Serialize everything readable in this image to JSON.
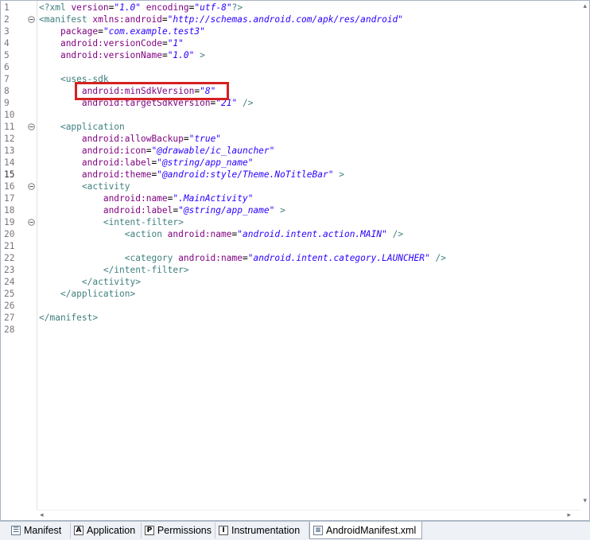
{
  "editor": {
    "lines": [
      {
        "n": "1",
        "fold": "",
        "tokens": [
          [
            "pi",
            "<?"
          ],
          [
            "tag",
            "xml "
          ],
          [
            "attr",
            "version"
          ],
          [
            "eq",
            "="
          ],
          [
            "val",
            "\"1.0\""
          ],
          [
            "eq",
            " "
          ],
          [
            "attr",
            "encoding"
          ],
          [
            "eq",
            "="
          ],
          [
            "val",
            "\"utf-8\""
          ],
          [
            "pi",
            "?>"
          ]
        ]
      },
      {
        "n": "2",
        "fold": "minus",
        "tokens": [
          [
            "tag",
            "<manifest "
          ],
          [
            "attr",
            "xmlns:android"
          ],
          [
            "eq",
            "="
          ],
          [
            "val",
            "\"http://schemas.android.com/apk/res/android\""
          ]
        ]
      },
      {
        "n": "3",
        "fold": "",
        "tokens": [
          [
            "eq",
            "    "
          ],
          [
            "attr",
            "package"
          ],
          [
            "eq",
            "="
          ],
          [
            "val",
            "\"com.example.test3\""
          ]
        ]
      },
      {
        "n": "4",
        "fold": "",
        "tokens": [
          [
            "eq",
            "    "
          ],
          [
            "attr",
            "android:versionCode"
          ],
          [
            "eq",
            "="
          ],
          [
            "val",
            "\"1\""
          ]
        ]
      },
      {
        "n": "5",
        "fold": "",
        "tokens": [
          [
            "eq",
            "    "
          ],
          [
            "attr",
            "android:versionName"
          ],
          [
            "eq",
            "="
          ],
          [
            "val",
            "\"1.0\""
          ],
          [
            "tag",
            " >"
          ]
        ]
      },
      {
        "n": "6",
        "fold": "",
        "tokens": []
      },
      {
        "n": "7",
        "fold": "",
        "tokens": [
          [
            "eq",
            "    "
          ],
          [
            "tag",
            "<uses-sdk"
          ]
        ]
      },
      {
        "n": "8",
        "fold": "",
        "tokens": [
          [
            "eq",
            "        "
          ],
          [
            "attr",
            "android:minSdkVersion"
          ],
          [
            "eq",
            "="
          ],
          [
            "val",
            "\"8\""
          ]
        ]
      },
      {
        "n": "9",
        "fold": "",
        "tokens": [
          [
            "eq",
            "        "
          ],
          [
            "attr",
            "android:targetSdkVersion"
          ],
          [
            "eq",
            "="
          ],
          [
            "val",
            "\"21\""
          ],
          [
            "tag",
            " />"
          ]
        ]
      },
      {
        "n": "10",
        "fold": "",
        "tokens": []
      },
      {
        "n": "11",
        "fold": "minus",
        "tokens": [
          [
            "eq",
            "    "
          ],
          [
            "tag",
            "<application"
          ]
        ]
      },
      {
        "n": "12",
        "fold": "",
        "tokens": [
          [
            "eq",
            "        "
          ],
          [
            "attr",
            "android:allowBackup"
          ],
          [
            "eq",
            "="
          ],
          [
            "val",
            "\"true\""
          ]
        ]
      },
      {
        "n": "13",
        "fold": "",
        "tokens": [
          [
            "eq",
            "        "
          ],
          [
            "attr",
            "android:icon"
          ],
          [
            "eq",
            "="
          ],
          [
            "val",
            "\"@drawable/ic_launcher\""
          ]
        ]
      },
      {
        "n": "14",
        "fold": "",
        "tokens": [
          [
            "eq",
            "        "
          ],
          [
            "attr",
            "android:label"
          ],
          [
            "eq",
            "="
          ],
          [
            "val",
            "\"@string/app_name\""
          ]
        ]
      },
      {
        "n": "15",
        "fold": "",
        "bold": true,
        "tokens": [
          [
            "eq",
            "        "
          ],
          [
            "attr",
            "android:theme"
          ],
          [
            "eq",
            "="
          ],
          [
            "val",
            "\"@android:style/Theme.NoTitleBar\""
          ],
          [
            "tag",
            " >"
          ]
        ]
      },
      {
        "n": "16",
        "fold": "minus",
        "tokens": [
          [
            "eq",
            "        "
          ],
          [
            "tag",
            "<activity"
          ]
        ]
      },
      {
        "n": "17",
        "fold": "",
        "tokens": [
          [
            "eq",
            "            "
          ],
          [
            "attr",
            "android:name"
          ],
          [
            "eq",
            "="
          ],
          [
            "val",
            "\".MainActivity\""
          ]
        ]
      },
      {
        "n": "18",
        "fold": "",
        "tokens": [
          [
            "eq",
            "            "
          ],
          [
            "attr",
            "android:label"
          ],
          [
            "eq",
            "="
          ],
          [
            "val",
            "\"@string/app_name\""
          ],
          [
            "tag",
            " >"
          ]
        ]
      },
      {
        "n": "19",
        "fold": "minus",
        "tokens": [
          [
            "eq",
            "            "
          ],
          [
            "tag",
            "<intent-filter>"
          ]
        ]
      },
      {
        "n": "20",
        "fold": "",
        "tokens": [
          [
            "eq",
            "                "
          ],
          [
            "tag",
            "<action "
          ],
          [
            "attr",
            "android:name"
          ],
          [
            "eq",
            "="
          ],
          [
            "val",
            "\"android.intent.action.MAIN\""
          ],
          [
            "tag",
            " />"
          ]
        ]
      },
      {
        "n": "21",
        "fold": "",
        "tokens": []
      },
      {
        "n": "22",
        "fold": "",
        "tokens": [
          [
            "eq",
            "                "
          ],
          [
            "tag",
            "<category "
          ],
          [
            "attr",
            "android:name"
          ],
          [
            "eq",
            "="
          ],
          [
            "val",
            "\"android.intent.category.LAUNCHER\""
          ],
          [
            "tag",
            " />"
          ]
        ]
      },
      {
        "n": "23",
        "fold": "",
        "tokens": [
          [
            "eq",
            "            "
          ],
          [
            "tag",
            "</intent-filter>"
          ]
        ]
      },
      {
        "n": "24",
        "fold": "",
        "tokens": [
          [
            "eq",
            "        "
          ],
          [
            "tag",
            "</activity>"
          ]
        ]
      },
      {
        "n": "25",
        "fold": "",
        "tokens": [
          [
            "eq",
            "    "
          ],
          [
            "tag",
            "</application>"
          ]
        ]
      },
      {
        "n": "26",
        "fold": "",
        "tokens": []
      },
      {
        "n": "27",
        "fold": "",
        "tokens": [
          [
            "tag",
            "</manifest>"
          ]
        ]
      },
      {
        "n": "28",
        "fold": "",
        "tokens": []
      }
    ]
  },
  "scroll": {
    "up_icon": "scroll-up-arrow-icon",
    "down_icon": "scroll-down-arrow-icon",
    "left_icon": "scroll-left-arrow-icon",
    "right_icon": "scroll-right-arrow-icon"
  },
  "tabs": [
    {
      "id": "manifest",
      "label": "Manifest",
      "icon": "manifest-icon",
      "glyph": "☰",
      "active": false
    },
    {
      "id": "application",
      "label": "Application",
      "icon": "application-icon",
      "glyph": "A",
      "active": false
    },
    {
      "id": "permissions",
      "label": "Permissions",
      "icon": "permissions-icon",
      "glyph": "P",
      "active": false
    },
    {
      "id": "instrumentation",
      "label": "Instrumentation",
      "icon": "instrumentation-icon",
      "glyph": "I",
      "active": false
    },
    {
      "id": "androidmanifest-xml",
      "label": "AndroidManifest.xml",
      "icon": "xml-file-icon",
      "glyph": "≡",
      "active": true
    }
  ],
  "colors": {
    "highlight_box": "#d62020",
    "tag": "#3f7f7f",
    "attribute": "#7f007f",
    "value": "#2a00ff"
  }
}
